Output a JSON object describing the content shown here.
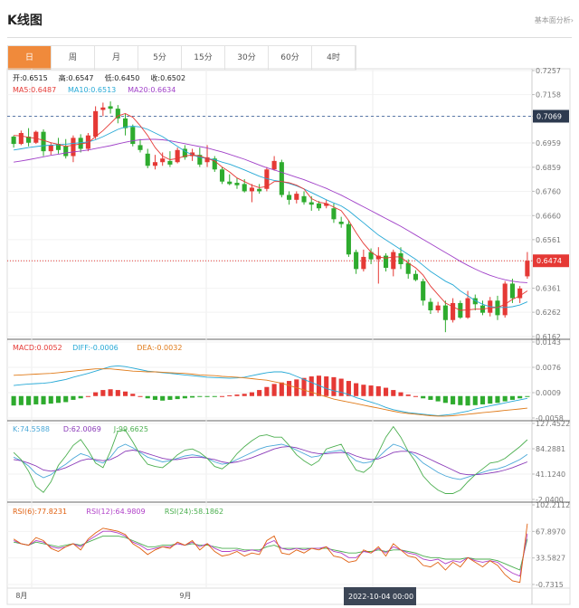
{
  "header": {
    "title": "K线图",
    "link_label": "基本面分析›"
  },
  "tabs": [
    "日",
    "周",
    "月",
    "5分",
    "15分",
    "30分",
    "60分",
    "4时"
  ],
  "active_tab": 0,
  "colors": {
    "up": "#e53935",
    "down": "#2eab2e",
    "accent": "#f08a3b",
    "ma5": "#e53935",
    "ma10": "#27a9d6",
    "ma20": "#a040c8",
    "macd": "#e53935",
    "diff": "#27a9d6",
    "dea": "#e07b1a"
  },
  "legends": {
    "ohlc": [
      {
        "label": "开:",
        "value": "0.6515"
      },
      {
        "label": "高:",
        "value": "0.6547"
      },
      {
        "label": "低:",
        "value": "0.6450"
      },
      {
        "label": "收:",
        "value": "0.6502"
      }
    ],
    "ma": [
      {
        "label": "MA5:",
        "value": "0.6487"
      },
      {
        "label": "MA10:",
        "value": "0.6513"
      },
      {
        "label": "MA20:",
        "value": "0.6634"
      }
    ],
    "macd": [
      {
        "label": "MACD:",
        "value": "0.0052"
      },
      {
        "label": "DIFF:",
        "value": "-0.0006"
      },
      {
        "label": "DEA:",
        "value": "-0.0032"
      }
    ],
    "kdj": [
      {
        "label": "K:",
        "value": "74.5588"
      },
      {
        "label": "D:",
        "value": "62.0069"
      },
      {
        "label": "J:",
        "value": "99.6625"
      }
    ],
    "rsi": [
      {
        "label": "RSI(6):",
        "value": "77.8231"
      },
      {
        "label": "RSI(12):",
        "value": "64.9809"
      },
      {
        "label": "RSI(24):",
        "value": "58.1862"
      }
    ]
  },
  "x_labels": [
    {
      "text": "8月",
      "i": 1
    },
    {
      "text": "9月",
      "i": 23
    }
  ],
  "cursor_label": "2022-10-04 00:00",
  "chart_data": {
    "type": "candlestick",
    "panels": {
      "price": {
        "ticks": [
          "0.7257",
          "0.7158",
          "0.7069",
          "0.6959",
          "0.6859",
          "0.6760",
          "0.6660",
          "0.6561",
          "0.6474",
          "0.6361",
          "0.6262",
          "0.6162"
        ],
        "ylim": [
          0.6162,
          0.7257
        ],
        "highlight": [
          "0.7069",
          "0.6474"
        ]
      },
      "macd": {
        "ticks": [
          "0.0143",
          "0.0076",
          "0.0009",
          "-0.0058"
        ],
        "ylim": [
          -0.0058,
          0.0143
        ]
      },
      "kdj": {
        "ticks": [
          "127.4522",
          "84.2881",
          "41.1240",
          "-2.0400"
        ],
        "ylim": [
          -2.04,
          127.4522
        ]
      },
      "rsi": {
        "ticks": [
          "102.2112",
          "67.8970",
          "33.5827",
          "-0.7315"
        ],
        "ylim": [
          -0.7315,
          102.2112
        ]
      }
    },
    "candles": [
      [
        0.6985,
        0.699,
        0.694,
        0.6955
      ],
      [
        0.6955,
        0.701,
        0.695,
        0.7
      ],
      [
        0.6985,
        0.702,
        0.6945,
        0.696
      ],
      [
        0.696,
        0.701,
        0.6955,
        0.7005
      ],
      [
        0.7005,
        0.7015,
        0.6905,
        0.6925
      ],
      [
        0.6925,
        0.696,
        0.691,
        0.695
      ],
      [
        0.6955,
        0.698,
        0.6915,
        0.693
      ],
      [
        0.6945,
        0.6975,
        0.6895,
        0.6905
      ],
      [
        0.6905,
        0.699,
        0.688,
        0.698
      ],
      [
        0.698,
        0.6995,
        0.692,
        0.6935
      ],
      [
        0.6935,
        0.7,
        0.6925,
        0.699
      ],
      [
        0.6985,
        0.711,
        0.6975,
        0.709
      ],
      [
        0.7095,
        0.7125,
        0.707,
        0.7105
      ],
      [
        0.711,
        0.713,
        0.708,
        0.71
      ],
      [
        0.71,
        0.7115,
        0.704,
        0.706
      ],
      [
        0.706,
        0.708,
        0.699,
        0.702
      ],
      [
        0.7025,
        0.7035,
        0.6945,
        0.6955
      ],
      [
        0.695,
        0.6975,
        0.692,
        0.693
      ],
      [
        0.6915,
        0.6935,
        0.6855,
        0.6865
      ],
      [
        0.6865,
        0.691,
        0.685,
        0.688
      ],
      [
        0.688,
        0.692,
        0.6865,
        0.6895
      ],
      [
        0.6885,
        0.6925,
        0.686,
        0.687
      ],
      [
        0.688,
        0.694,
        0.6875,
        0.693
      ],
      [
        0.6935,
        0.695,
        0.689,
        0.69
      ],
      [
        0.6905,
        0.6935,
        0.6885,
        0.692
      ],
      [
        0.691,
        0.694,
        0.686,
        0.687
      ],
      [
        0.688,
        0.695,
        0.686,
        0.69
      ],
      [
        0.6895,
        0.6905,
        0.684,
        0.685
      ],
      [
        0.685,
        0.686,
        0.679,
        0.68
      ],
      [
        0.68,
        0.683,
        0.6785,
        0.679
      ],
      [
        0.6795,
        0.6815,
        0.677,
        0.6785
      ],
      [
        0.679,
        0.681,
        0.6755,
        0.676
      ],
      [
        0.676,
        0.679,
        0.6715,
        0.6775
      ],
      [
        0.677,
        0.679,
        0.675,
        0.676
      ],
      [
        0.677,
        0.686,
        0.676,
        0.685
      ],
      [
        0.685,
        0.6905,
        0.6845,
        0.6885
      ],
      [
        0.688,
        0.689,
        0.6735,
        0.6745
      ],
      [
        0.6745,
        0.676,
        0.6705,
        0.6725
      ],
      [
        0.6725,
        0.676,
        0.671,
        0.675
      ],
      [
        0.674,
        0.676,
        0.6705,
        0.6715
      ],
      [
        0.6715,
        0.674,
        0.668,
        0.6705
      ],
      [
        0.671,
        0.672,
        0.668,
        0.669
      ],
      [
        0.67,
        0.6725,
        0.669,
        0.671
      ],
      [
        0.669,
        0.671,
        0.663,
        0.6645
      ],
      [
        0.6635,
        0.6655,
        0.661,
        0.6625
      ],
      [
        0.6625,
        0.664,
        0.649,
        0.65
      ],
      [
        0.651,
        0.652,
        0.642,
        0.644
      ],
      [
        0.644,
        0.652,
        0.643,
        0.649
      ],
      [
        0.651,
        0.6525,
        0.646,
        0.648
      ],
      [
        0.648,
        0.653,
        0.638,
        0.6495
      ],
      [
        0.6495,
        0.6505,
        0.643,
        0.6445
      ],
      [
        0.644,
        0.652,
        0.641,
        0.651
      ],
      [
        0.6505,
        0.653,
        0.644,
        0.646
      ],
      [
        0.6465,
        0.648,
        0.64,
        0.642
      ],
      [
        0.642,
        0.6435,
        0.639,
        0.6395
      ],
      [
        0.639,
        0.64,
        0.629,
        0.631
      ],
      [
        0.6305,
        0.632,
        0.6255,
        0.627
      ],
      [
        0.627,
        0.6305,
        0.626,
        0.629
      ],
      [
        0.629,
        0.631,
        0.618,
        0.623
      ],
      [
        0.623,
        0.632,
        0.622,
        0.63
      ],
      [
        0.63,
        0.631,
        0.6235,
        0.624
      ],
      [
        0.624,
        0.635,
        0.6235,
        0.632
      ],
      [
        0.632,
        0.6335,
        0.627,
        0.6295
      ],
      [
        0.629,
        0.631,
        0.625,
        0.626
      ],
      [
        0.626,
        0.6325,
        0.6245,
        0.631
      ],
      [
        0.631,
        0.633,
        0.623,
        0.625
      ],
      [
        0.625,
        0.639,
        0.624,
        0.638
      ],
      [
        0.638,
        0.64,
        0.63,
        0.632
      ],
      [
        0.632,
        0.637,
        0.63,
        0.636
      ],
      [
        0.641,
        0.651,
        0.64,
        0.6474
      ]
    ],
    "ma5": [
      0.699,
      0.6988,
      0.6982,
      0.6978,
      0.697,
      0.696,
      0.6953,
      0.6945,
      0.695,
      0.6955,
      0.696,
      0.6985,
      0.701,
      0.704,
      0.707,
      0.708,
      0.7065,
      0.703,
      0.699,
      0.694,
      0.6905,
      0.689,
      0.6895,
      0.6905,
      0.691,
      0.6905,
      0.6895,
      0.6885,
      0.686,
      0.684,
      0.6815,
      0.68,
      0.6785,
      0.6775,
      0.678,
      0.68,
      0.68,
      0.6795,
      0.6785,
      0.677,
      0.673,
      0.6715,
      0.671,
      0.6695,
      0.668,
      0.664,
      0.659,
      0.6545,
      0.651,
      0.649,
      0.6485,
      0.649,
      0.649,
      0.6465,
      0.6445,
      0.6415,
      0.637,
      0.6335,
      0.63,
      0.6285,
      0.627,
      0.6272,
      0.6275,
      0.6275,
      0.628,
      0.6282,
      0.6295,
      0.6315,
      0.633,
      0.635
    ],
    "ma10": [
      0.693,
      0.6935,
      0.694,
      0.6944,
      0.6948,
      0.695,
      0.6952,
      0.6954,
      0.6957,
      0.696,
      0.6963,
      0.6972,
      0.6985,
      0.7,
      0.7015,
      0.7025,
      0.7028,
      0.7025,
      0.7015,
      0.7,
      0.6985,
      0.6965,
      0.6945,
      0.6925,
      0.691,
      0.69,
      0.6895,
      0.689,
      0.688,
      0.6872,
      0.686,
      0.6848,
      0.6835,
      0.6822,
      0.6812,
      0.6805,
      0.68,
      0.6792,
      0.6782,
      0.677,
      0.6755,
      0.674,
      0.6725,
      0.6712,
      0.67,
      0.668,
      0.6655,
      0.663,
      0.6605,
      0.658,
      0.656,
      0.654,
      0.652,
      0.65,
      0.648,
      0.6455,
      0.643,
      0.641,
      0.639,
      0.6375,
      0.635,
      0.633,
      0.631,
      0.6295,
      0.6285,
      0.6282,
      0.6282,
      0.6285,
      0.6292,
      0.6305
    ],
    "ma20": [
      0.688,
      0.6885,
      0.689,
      0.6896,
      0.6902,
      0.6908,
      0.6913,
      0.6918,
      0.6922,
      0.6926,
      0.693,
      0.6936,
      0.6942,
      0.6948,
      0.6955,
      0.6962,
      0.6968,
      0.6972,
      0.6974,
      0.6974,
      0.6972,
      0.6968,
      0.6962,
      0.6956,
      0.695,
      0.6944,
      0.6938,
      0.693,
      0.6922,
      0.6912,
      0.6902,
      0.6892,
      0.688,
      0.6868,
      0.6857,
      0.6848,
      0.6838,
      0.6828,
      0.6818,
      0.6808,
      0.6796,
      0.6784,
      0.6772,
      0.6758,
      0.6744,
      0.6728,
      0.6712,
      0.6696,
      0.668,
      0.6664,
      0.6648,
      0.6632,
      0.6616,
      0.6598,
      0.658,
      0.6562,
      0.6544,
      0.6526,
      0.6508,
      0.649,
      0.6472,
      0.6455,
      0.644,
      0.6426,
      0.6414,
      0.6404,
      0.6396,
      0.639,
      0.6386,
      0.6384
    ],
    "macd_hist": [
      -0.0025,
      -0.0024,
      -0.0024,
      -0.0022,
      -0.0022,
      -0.002,
      -0.0018,
      -0.0016,
      -0.001,
      -0.0006,
      0.0,
      0.001,
      0.0016,
      0.0018,
      0.0016,
      0.0012,
      0.0006,
      0.0,
      -0.0006,
      -0.001,
      -0.0012,
      -0.001,
      -0.0008,
      -0.0006,
      -0.0004,
      -0.0002,
      -0.0002,
      -0.0002,
      0.0,
      0.0002,
      0.0004,
      0.0006,
      0.001,
      0.0016,
      0.0024,
      0.0032,
      0.0036,
      0.004,
      0.0044,
      0.0048,
      0.0052,
      0.0054,
      0.0052,
      0.005,
      0.0046,
      0.004,
      0.0034,
      0.003,
      0.0028,
      0.0026,
      0.0022,
      0.0016,
      0.001,
      0.0004,
      0.0,
      -0.0006,
      -0.001,
      -0.0014,
      -0.0018,
      -0.0022,
      -0.0024,
      -0.0025,
      -0.0024,
      -0.0022,
      -0.002,
      -0.0018,
      -0.0014,
      -0.001,
      -0.0006,
      -0.0002
    ],
    "diff": [
      0.0028,
      0.003,
      0.0032,
      0.0033,
      0.0034,
      0.0036,
      0.004,
      0.0044,
      0.005,
      0.0055,
      0.006,
      0.0066,
      0.0072,
      0.0078,
      0.008,
      0.0078,
      0.0074,
      0.007,
      0.0066,
      0.0064,
      0.0062,
      0.006,
      0.0058,
      0.0056,
      0.0054,
      0.0052,
      0.005,
      0.0049,
      0.0048,
      0.0047,
      0.0048,
      0.005,
      0.0054,
      0.0058,
      0.0062,
      0.0064,
      0.0064,
      0.006,
      0.0052,
      0.0044,
      0.0036,
      0.0028,
      0.002,
      0.0014,
      0.001,
      0.0004,
      -0.0004,
      -0.001,
      -0.0016,
      -0.0022,
      -0.003,
      -0.0036,
      -0.004,
      -0.0044,
      -0.0046,
      -0.0048,
      -0.005,
      -0.0052,
      -0.005,
      -0.0048,
      -0.0044,
      -0.004,
      -0.0034,
      -0.003,
      -0.0026,
      -0.0022,
      -0.0018,
      -0.0014,
      -0.001,
      -0.0006
    ],
    "dea": [
      0.0055,
      0.0056,
      0.0057,
      0.0058,
      0.0059,
      0.006,
      0.0062,
      0.0064,
      0.0066,
      0.0068,
      0.007,
      0.0072,
      0.0072,
      0.0072,
      0.007,
      0.0068,
      0.0066,
      0.0065,
      0.0064,
      0.0064,
      0.0063,
      0.0062,
      0.0061,
      0.006,
      0.0058,
      0.0056,
      0.0055,
      0.0054,
      0.0052,
      0.0051,
      0.005,
      0.0048,
      0.0046,
      0.0044,
      0.0042,
      0.0038,
      0.0034,
      0.0028,
      0.0022,
      0.0016,
      0.001,
      0.0004,
      -0.0002,
      -0.0008,
      -0.0012,
      -0.0016,
      -0.002,
      -0.0024,
      -0.0028,
      -0.0032,
      -0.0036,
      -0.004,
      -0.0044,
      -0.0046,
      -0.0048,
      -0.005,
      -0.0052,
      -0.0053,
      -0.0053,
      -0.0052,
      -0.005,
      -0.0048,
      -0.0046,
      -0.0044,
      -0.0042,
      -0.004,
      -0.0038,
      -0.0036,
      -0.0034,
      -0.0032
    ],
    "kdj_k": [
      70,
      64,
      55,
      42,
      35,
      40,
      50,
      58,
      68,
      76,
      72,
      64,
      60,
      70,
      86,
      92,
      86,
      78,
      70,
      66,
      62,
      64,
      68,
      72,
      74,
      72,
      68,
      62,
      58,
      60,
      66,
      72,
      78,
      84,
      88,
      90,
      92,
      88,
      82,
      76,
      70,
      72,
      78,
      80,
      82,
      74,
      64,
      60,
      62,
      70,
      82,
      92,
      88,
      80,
      72,
      60,
      52,
      44,
      38,
      34,
      32,
      36,
      40,
      44,
      48,
      50,
      54,
      60,
      66,
      74.5588
    ],
    "kdj_d": [
      66,
      64,
      60,
      55,
      48,
      46,
      48,
      52,
      58,
      64,
      67,
      66,
      64,
      66,
      72,
      80,
      82,
      80,
      76,
      72,
      68,
      66,
      66,
      68,
      70,
      70,
      68,
      66,
      62,
      60,
      62,
      65,
      69,
      74,
      79,
      84,
      87,
      88,
      86,
      82,
      78,
      76,
      76,
      77,
      78,
      77,
      72,
      68,
      66,
      67,
      72,
      78,
      80,
      80,
      77,
      72,
      66,
      60,
      54,
      48,
      42,
      40,
      40,
      41,
      43,
      45,
      48,
      52,
      57,
      62.0069
    ],
    "kdj_j": [
      78,
      66,
      46,
      20,
      10,
      28,
      56,
      72,
      90,
      100,
      82,
      60,
      52,
      80,
      114,
      116,
      96,
      74,
      58,
      54,
      52,
      62,
      74,
      82,
      84,
      78,
      68,
      54,
      50,
      60,
      76,
      88,
      98,
      106,
      108,
      104,
      104,
      90,
      74,
      64,
      56,
      64,
      84,
      88,
      92,
      68,
      48,
      44,
      54,
      78,
      104,
      122,
      104,
      80,
      62,
      38,
      24,
      14,
      8,
      8,
      14,
      28,
      40,
      50,
      60,
      62,
      68,
      78,
      88,
      99.6625
    ],
    "rsi6": [
      58,
      52,
      50,
      60,
      56,
      46,
      42,
      48,
      52,
      44,
      58,
      66,
      72,
      70,
      68,
      64,
      52,
      46,
      38,
      44,
      48,
      46,
      54,
      50,
      56,
      44,
      52,
      42,
      36,
      38,
      42,
      36,
      40,
      38,
      56,
      62,
      40,
      38,
      44,
      40,
      46,
      44,
      48,
      36,
      34,
      28,
      30,
      44,
      40,
      48,
      36,
      52,
      44,
      36,
      34,
      24,
      22,
      28,
      18,
      28,
      22,
      34,
      28,
      22,
      30,
      24,
      12,
      4,
      2,
      77.8231
    ],
    "rsi12": [
      56,
      52,
      50,
      56,
      54,
      48,
      46,
      48,
      52,
      48,
      56,
      62,
      68,
      68,
      66,
      62,
      54,
      50,
      44,
      46,
      48,
      48,
      52,
      50,
      54,
      48,
      52,
      46,
      42,
      42,
      44,
      42,
      44,
      42,
      52,
      56,
      46,
      44,
      46,
      44,
      46,
      46,
      48,
      42,
      40,
      34,
      34,
      42,
      40,
      46,
      40,
      48,
      44,
      40,
      38,
      32,
      30,
      32,
      26,
      30,
      28,
      34,
      30,
      28,
      30,
      28,
      20,
      14,
      10,
      64.9809
    ],
    "rsi24": [
      54,
      52,
      50,
      54,
      52,
      50,
      48,
      50,
      52,
      50,
      54,
      58,
      62,
      62,
      62,
      60,
      56,
      52,
      48,
      48,
      50,
      50,
      52,
      50,
      52,
      50,
      50,
      48,
      46,
      46,
      46,
      44,
      44,
      44,
      48,
      50,
      46,
      46,
      46,
      46,
      46,
      46,
      46,
      44,
      42,
      40,
      40,
      42,
      42,
      44,
      42,
      44,
      44,
      42,
      40,
      36,
      34,
      34,
      32,
      32,
      32,
      34,
      32,
      32,
      32,
      30,
      26,
      22,
      18,
      58.1862
    ]
  }
}
